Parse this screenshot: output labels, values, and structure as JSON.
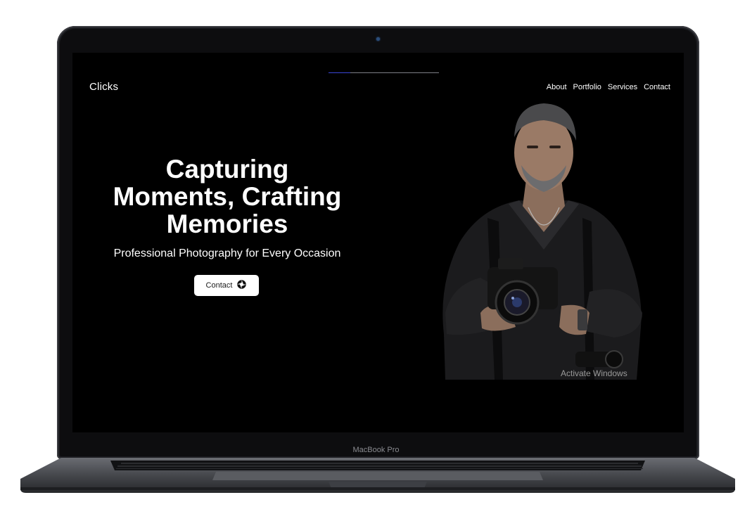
{
  "device": {
    "model_label": "MacBook Pro"
  },
  "site": {
    "brand": "Clicks",
    "nav": [
      {
        "label": "About"
      },
      {
        "label": "Portfolio"
      },
      {
        "label": "Services"
      },
      {
        "label": "Contact"
      }
    ],
    "scroll_progress": 0.2,
    "hero": {
      "title_lines": [
        "Capturing",
        "Moments, Crafting",
        "Memories"
      ],
      "subtitle": "Professional Photography for Every Occasion",
      "cta_label": "Contact",
      "cta_icon": "aperture-icon"
    }
  },
  "os_overlay": {
    "watermark": "Activate Windows"
  },
  "colors": {
    "screen_background": "#000000",
    "text": "#ffffff",
    "cta_background": "#ffffff",
    "progress_fill": "#3a46d6"
  }
}
